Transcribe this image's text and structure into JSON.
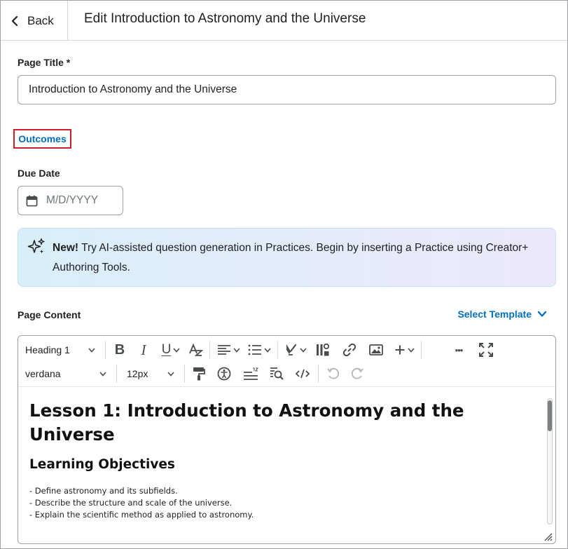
{
  "header": {
    "back_label": "Back",
    "title": "Edit Introduction to Astronomy and the Universe"
  },
  "form": {
    "page_title_label": "Page Title *",
    "page_title_value": "Introduction to Astronomy and the Universe",
    "outcomes_link": "Outcomes",
    "due_date_label": "Due Date",
    "due_date_placeholder": "M/D/YYYY"
  },
  "banner": {
    "bold": "New!",
    "text": " Try AI-assisted question generation in Practices. Begin by inserting a Practice using Creator+ Authoring Tools."
  },
  "page_content": {
    "label": "Page Content",
    "select_template": "Select Template"
  },
  "toolbar": {
    "block_format": "Heading 1",
    "font_family": "verdana",
    "font_size": "12px",
    "bold_glyph": "B",
    "italic_glyph": "I",
    "underline_glyph": "U",
    "more_glyph": "•••"
  },
  "document": {
    "heading": "Lesson 1: Introduction to Astronomy and the Universe",
    "subheading": "Learning Objectives",
    "objectives": [
      "- Define astronomy and its subfields.",
      "- Describe the structure and scale of the universe.",
      "- Explain the scientific method as applied to astronomy."
    ]
  },
  "colors": {
    "link": "#006fbf",
    "highlight_border": "#cd2026",
    "banner_bg": "#d8eefb",
    "icon": "#494c4e"
  },
  "icons": [
    "chevron-left-icon",
    "calendar-icon",
    "sparkle-icon",
    "chevron-down-icon",
    "bold-icon",
    "italic-icon",
    "underline-icon",
    "strikethrough-format-icon",
    "align-left-icon",
    "bulleted-list-icon",
    "highlighter-icon",
    "insert-stuff-icon",
    "link-icon",
    "image-icon",
    "plus-icon",
    "more-icon",
    "fullscreen-icon",
    "format-painter-icon",
    "accessibility-icon",
    "word-count-icon",
    "find-replace-icon",
    "source-code-icon",
    "undo-icon",
    "redo-icon"
  ]
}
